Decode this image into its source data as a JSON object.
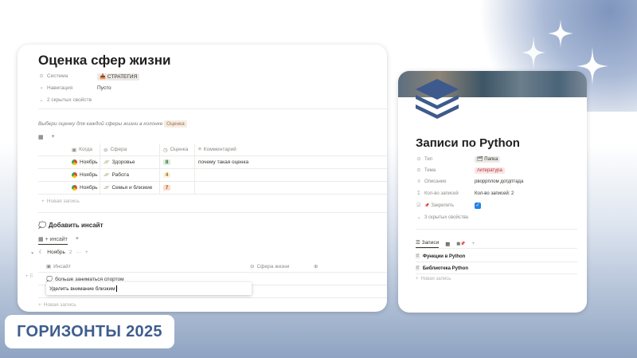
{
  "left": {
    "title": "Оценка сфер жизни",
    "props": [
      {
        "icon": "⊙",
        "label": "Система",
        "value": "📥 СТРАТЕГИЯ",
        "tag": true
      },
      {
        "icon": "⌁",
        "label": "Навигация",
        "value": "Пусто",
        "tag": false
      }
    ],
    "hidden_props": "2 скрытых свойств",
    "hint_text": "Выбери оценку для каждой сферы жизни в колонке",
    "hint_tag": "Оценка",
    "table": {
      "headers": [
        "Когда",
        "Сфера",
        "Оценка",
        "Комментарий"
      ],
      "rows": [
        {
          "when": "Ноябрь",
          "sphere": "Здоровье",
          "score": "8",
          "comment": "почему такая оценка"
        },
        {
          "when": "Ноябрь",
          "sphere": "Работа",
          "score": "4",
          "comment": ""
        },
        {
          "when": "Ноябрь",
          "sphere": "Семья и близкие",
          "score": "7",
          "comment": ""
        }
      ],
      "new_row": "Новая запись"
    },
    "insight_title": "Добавить инсайт",
    "insight_view": "+ инсайт",
    "group": {
      "label": "Ноябрь",
      "count": "2",
      "more": "···"
    },
    "insight_table": {
      "headers": [
        "Инсайт",
        "Сфера жизни"
      ],
      "rows": [
        "больше заниматься спортом",
        "Уделить внимание близким"
      ],
      "new_row": "Новая запись"
    }
  },
  "right": {
    "title": "Записи по Python",
    "props": [
      {
        "icon": "⊙",
        "label": "Тип",
        "value": "🗂 Папка",
        "style": "tag"
      },
      {
        "icon": "⊙",
        "label": "Тема",
        "value": "литература",
        "style": "tag-red"
      },
      {
        "icon": "≡",
        "label": "Описание",
        "value": "рвоpрплом дотдптада",
        "style": "plain"
      },
      {
        "icon": "Σ",
        "label": "Кол-во записей",
        "value": "Кол-во записей: 2",
        "style": "plain"
      },
      {
        "icon": "📌",
        "label": "Закрепить",
        "value": "✓",
        "style": "check"
      }
    ],
    "hidden_props": "3 скрытых свойства",
    "tabs": [
      "Записи",
      "📌"
    ],
    "items": [
      "Функции в Python",
      "Библиотека Python"
    ],
    "new_row": "Новая запись"
  },
  "badge": "ГОРИЗОНТЫ 2025"
}
